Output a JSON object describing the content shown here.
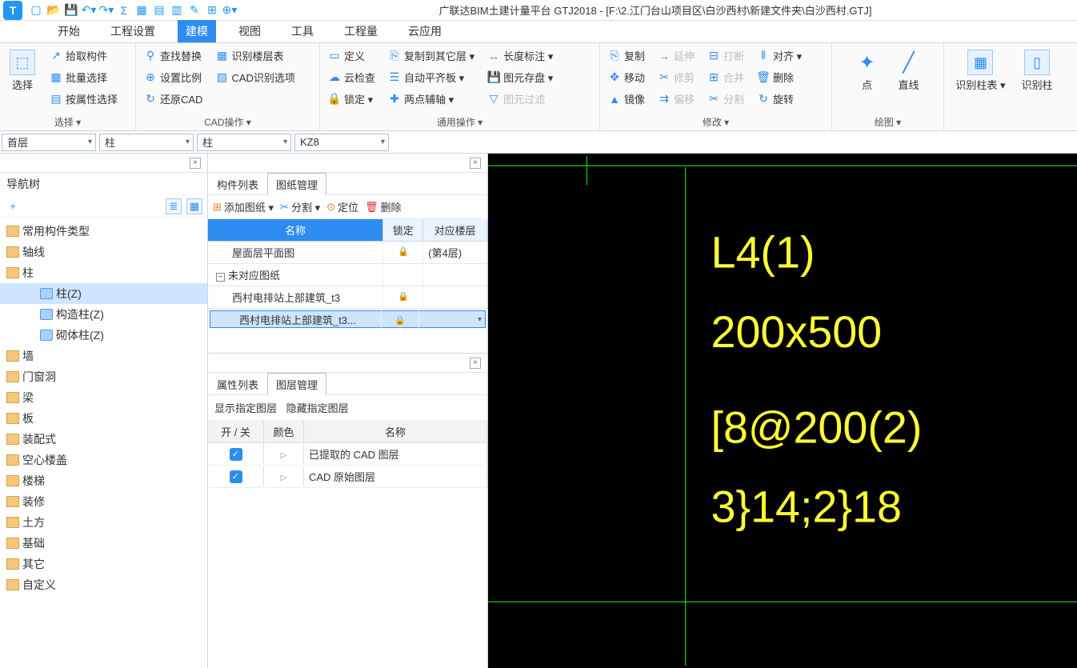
{
  "title": "广联达BIM土建计量平台 GTJ2018 - [F:\\2.江门台山项目区\\白沙西村\\新建文件夹\\白沙西村.GTJ]",
  "logo": "T",
  "menu": {
    "tabs": [
      "开始",
      "工程设置",
      "建模",
      "视图",
      "工具",
      "工程量",
      "云应用"
    ],
    "active": "建模"
  },
  "ribbon": {
    "g1": {
      "label": "选择 ▾",
      "big": "选择",
      "items": [
        "拾取构件",
        "批量选择",
        "按属性选择"
      ]
    },
    "g2": {
      "label": "CAD操作 ▾",
      "col1": [
        "查找替换",
        "设置比例",
        "还原CAD"
      ],
      "col2": [
        "识别楼层表",
        "CAD识别选项"
      ]
    },
    "g3": {
      "label": "通用操作 ▾",
      "col1": [
        "定义",
        "云检查",
        "锁定 ▾"
      ],
      "col2": [
        "复制到其它层 ▾",
        "自动平齐板 ▾",
        "两点辅轴 ▾"
      ],
      "col3": [
        "长度标注 ▾",
        "图元存盘 ▾",
        "图元过滤"
      ]
    },
    "g4": {
      "label": "修改 ▾",
      "col1": [
        "复制",
        "移动",
        "镜像"
      ],
      "col2": [
        "延伸",
        "修剪",
        "偏移"
      ],
      "col3": [
        "打断",
        "合并",
        "分割"
      ],
      "col4": [
        "对齐 ▾",
        "删除",
        "旋转"
      ]
    },
    "g5": {
      "label": "绘图 ▾",
      "items": [
        "点",
        "直线"
      ]
    },
    "g6": {
      "items": [
        "识别柱表 ▾",
        "识别柱"
      ]
    }
  },
  "selectors": {
    "floor": "首层",
    "group": "柱",
    "type": "柱",
    "member": "KZ8"
  },
  "nav": {
    "title": "导航树",
    "items": [
      {
        "label": "常用构件类型",
        "type": "folder"
      },
      {
        "label": "轴线",
        "type": "folder"
      },
      {
        "label": "柱",
        "type": "folder",
        "expanded": true,
        "children": [
          {
            "label": "柱(Z)",
            "selected": true
          },
          {
            "label": "构造柱(Z)"
          },
          {
            "label": "砌体柱(Z)"
          }
        ]
      },
      {
        "label": "墙",
        "type": "folder"
      },
      {
        "label": "门窗洞",
        "type": "folder"
      },
      {
        "label": "梁",
        "type": "folder"
      },
      {
        "label": "板",
        "type": "folder"
      },
      {
        "label": "装配式",
        "type": "folder"
      },
      {
        "label": "空心楼盖",
        "type": "folder"
      },
      {
        "label": "楼梯",
        "type": "folder"
      },
      {
        "label": "装修",
        "type": "folder"
      },
      {
        "label": "土方",
        "type": "folder"
      },
      {
        "label": "基础",
        "type": "folder"
      },
      {
        "label": "其它",
        "type": "folder"
      },
      {
        "label": "自定义",
        "type": "folder"
      }
    ]
  },
  "midTop": {
    "tabs": [
      "构件列表",
      "图纸管理"
    ],
    "active": "图纸管理",
    "toolbar": {
      "add": "添加图纸 ▾",
      "split": "分割 ▾",
      "locate": "定位",
      "del": "删除"
    },
    "head": {
      "name": "名称",
      "lock": "锁定",
      "floor": "对应楼层"
    },
    "rows": [
      {
        "name": "屋面层平面图",
        "lock": "🔒",
        "floor": "(第4层)",
        "indent": 1
      },
      {
        "name": "未对应图纸",
        "lock": "",
        "floor": "",
        "indent": 0,
        "group": true
      },
      {
        "name": "西村电排站上部建筑_t3",
        "lock": "🔒",
        "floor": "",
        "indent": 1
      },
      {
        "name": "西村电排站上部建筑_t3...",
        "lock": "🔒",
        "floor": "",
        "indent": 1,
        "selected": true
      }
    ]
  },
  "midBottom": {
    "tabs": [
      "属性列表",
      "图层管理"
    ],
    "active": "图层管理",
    "toolbar": {
      "show": "显示指定图层",
      "hide": "隐藏指定图层"
    },
    "head": {
      "onoff": "开 / 关",
      "color": "颜色",
      "name": "名称"
    },
    "rows": [
      {
        "name": "已提取的 CAD 图层"
      },
      {
        "name": "CAD 原始图层"
      }
    ]
  },
  "canvas": {
    "lines": [
      "L4(1)",
      "200x500",
      "[8@200(2)",
      "3}14;2}18"
    ]
  }
}
